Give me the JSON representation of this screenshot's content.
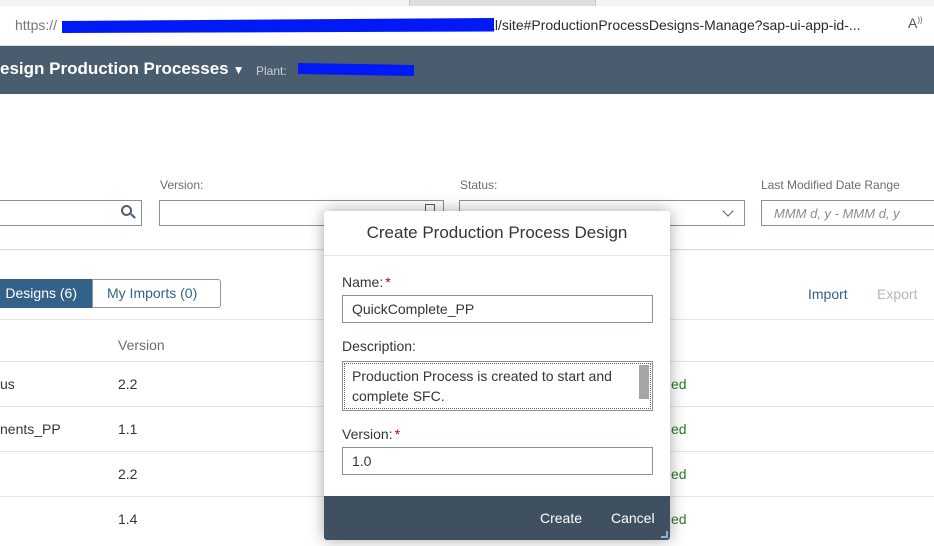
{
  "browser": {
    "url_scheme": "https://",
    "url_path": "al/site#ProductionProcessDesigns-Manage?sap-ui-app-id-...",
    "reader_icon": "reader-mode-icon"
  },
  "shell": {
    "app_title": "esign Production Processes",
    "plant_label": "Plant:"
  },
  "filters": {
    "version_label": "Version:",
    "status_label": "Status:",
    "last_modified_label": "Last Modified Date Range",
    "date_placeholder": "MMM d, y - MMM d, y"
  },
  "tabs": {
    "designs": "Designs (6)",
    "imports": "My Imports (0)"
  },
  "table": {
    "import_label": "Import",
    "export_label": "Export",
    "version_header": "Version",
    "rows": [
      {
        "name": "us",
        "version": "2.2",
        "status": "ed"
      },
      {
        "name": "nents_PP",
        "version": "1.1",
        "status": "ed"
      },
      {
        "name": "",
        "version": "2.2",
        "status": "ed"
      },
      {
        "name": "",
        "version": "1.4",
        "status": "ed"
      }
    ]
  },
  "dialog": {
    "title": "Create Production Process Design",
    "name_label": "Name:",
    "name_value": "QuickComplete_PP",
    "description_label": "Description:",
    "description_value": "Production Process is created to start and complete SFC.",
    "version_label": "Version:",
    "version_value": "1.0",
    "required_mark": "*",
    "create_label": "Create",
    "cancel_label": "Cancel"
  },
  "colors": {
    "shell_header": "#4a5d6f",
    "dialog_footer": "#3f5161",
    "active_tab": "#346187",
    "required": "#bb0000",
    "redaction": "#0019f7"
  }
}
